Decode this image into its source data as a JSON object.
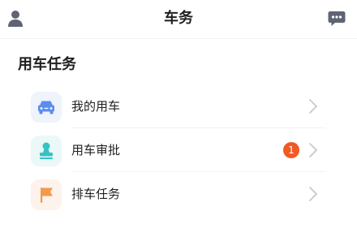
{
  "header": {
    "title": "车务",
    "left_icon": "user-icon",
    "right_icon": "message-icon"
  },
  "section": {
    "title": "用车任务"
  },
  "items": [
    {
      "label": "我的用车",
      "icon": "car-icon",
      "icon_bg": "#eef3fc",
      "icon_color": "#5b8def",
      "badge": ""
    },
    {
      "label": "用车审批",
      "icon": "stamp-icon",
      "icon_bg": "#eaf8f8",
      "icon_color": "#36c2c4",
      "badge": "1"
    },
    {
      "label": "排车任务",
      "icon": "flag-icon",
      "icon_bg": "#fdf2ec",
      "icon_color": "#f29a4b",
      "badge": ""
    }
  ],
  "colors": {
    "badge": "#f15a24",
    "icon_gray": "#5f6473",
    "chevron": "#c6c6c6"
  }
}
